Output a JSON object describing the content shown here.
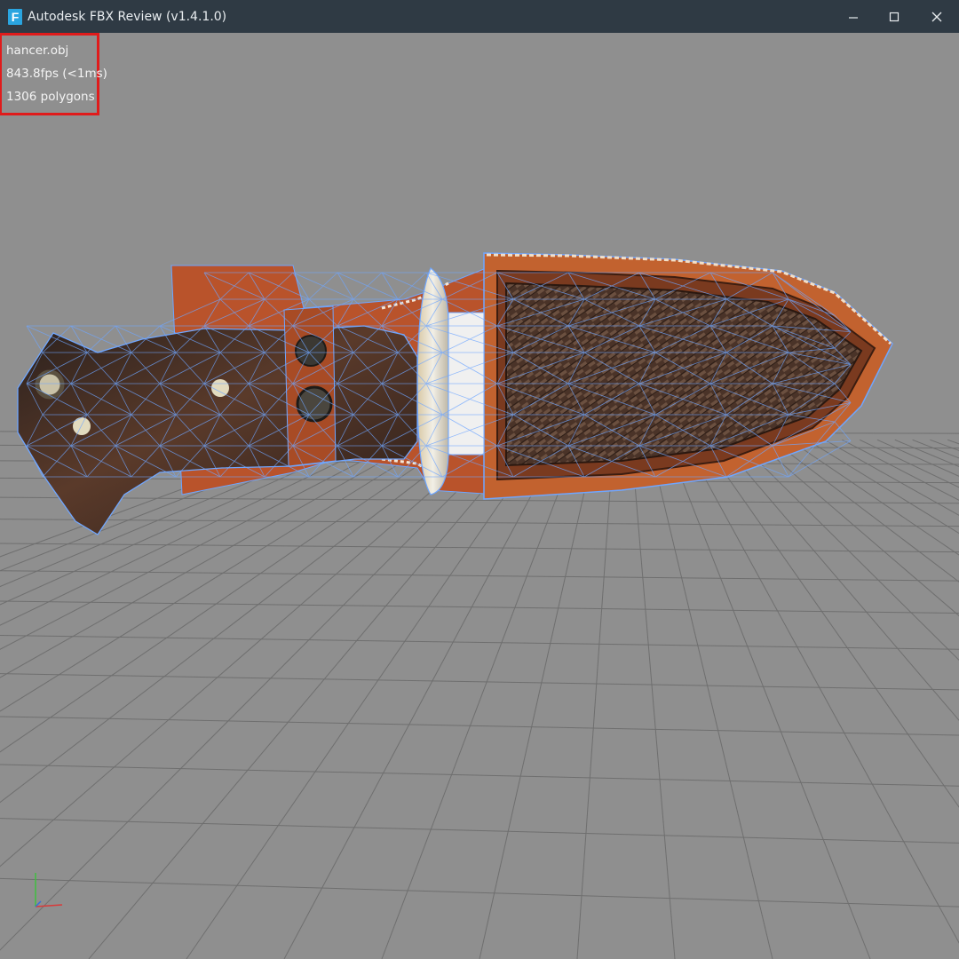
{
  "window": {
    "title": "Autodesk FBX Review (v1.4.1.0)",
    "app_icon_letter": "F",
    "controls": [
      "minimize",
      "maximize",
      "close"
    ]
  },
  "viewport": {
    "stats": {
      "file_name": "hancer.obj",
      "fps": "843.8fps (<1ms)",
      "polygons": "1306 polygons"
    },
    "model": "knife in leather sheath (textured with wireframe overlay)",
    "grid": "on",
    "axis_gizmo": [
      "x-axis",
      "y-axis"
    ]
  },
  "colors": {
    "titlebar": "#2f3a44",
    "viewport_background": "#8f8f8f",
    "grid_lines": "#6f6f6f",
    "stats_highlight": "#e01b1b",
    "wireframe": "#6fa6ff",
    "leather": "#b9532b",
    "handle_wood": "#3a2a22"
  }
}
